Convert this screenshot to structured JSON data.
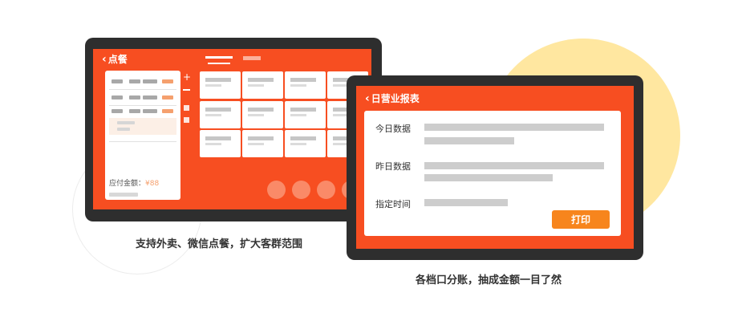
{
  "pos_tablet": {
    "title": "点餐",
    "tabs": [
      {
        "color": "#ffffff"
      },
      {
        "color": "#fcb09a"
      }
    ],
    "total_label": "应付金额：",
    "total_amount": "¥88"
  },
  "report_tablet": {
    "title": "日营业报表",
    "rows": [
      "今日数据",
      "昨日数据",
      "指定时间"
    ],
    "print_label": "打印"
  },
  "captions": {
    "left": "支持外卖、微信点餐，扩大客群范围",
    "right": "各档口分账，抽成金额一目了然"
  },
  "colors": {
    "accent": "#f74e21",
    "bezel": "#2e2e2e",
    "button": "#f7851d",
    "highlight": "#ffe7a0"
  }
}
